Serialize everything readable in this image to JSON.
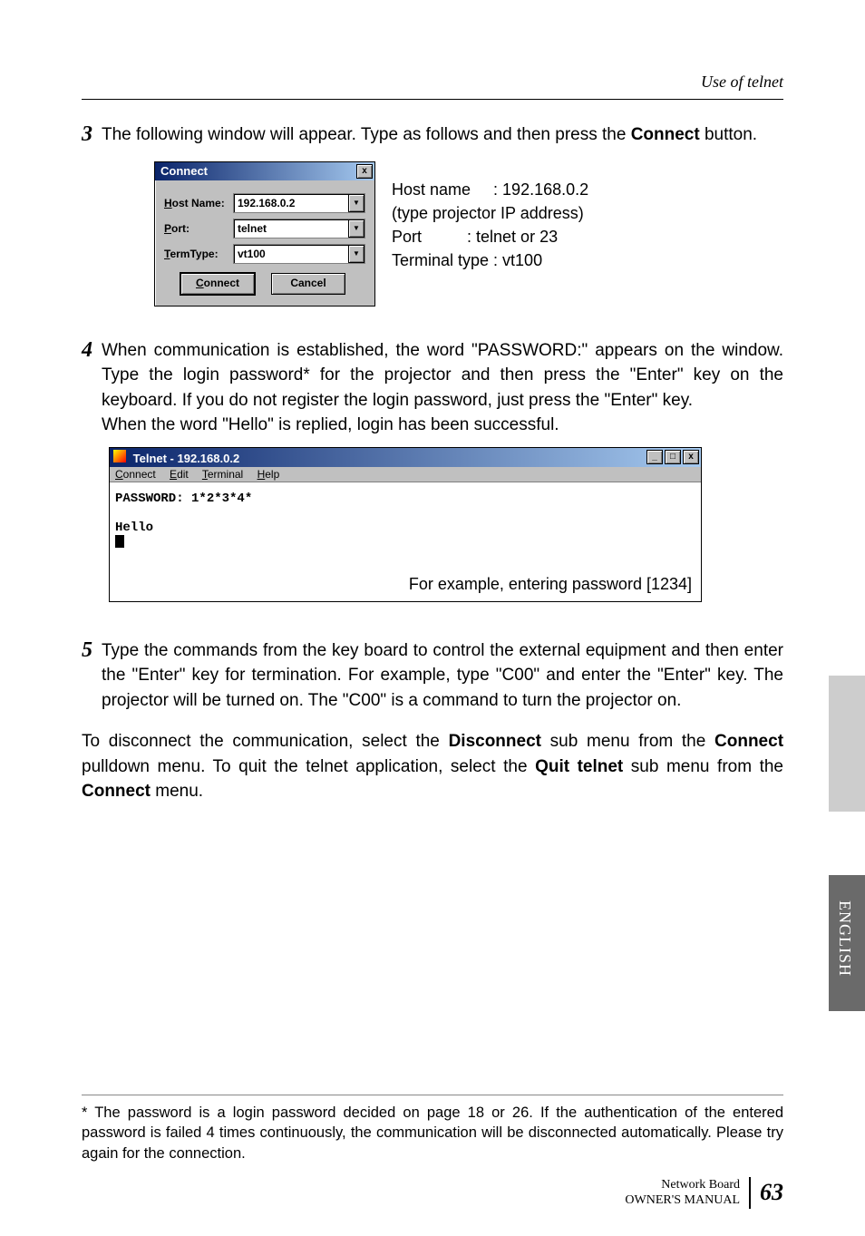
{
  "header": {
    "section": "Use of telnet"
  },
  "step3": {
    "num": "3",
    "text_a": "The following window will appear. Type as follows and then press the ",
    "connect_word": "Connect",
    "text_b": " button."
  },
  "connect_dialog": {
    "title": "Connect",
    "close_glyph": "x",
    "host_label": "Host Name:",
    "host_value": "192.168.0.2",
    "port_label": "Port:",
    "port_value": "telnet",
    "term_label": "TermType:",
    "term_value": "vt100",
    "dd_glyph": "▼",
    "btn_connect": "Connect",
    "btn_cancel": "Cancel"
  },
  "side_info": {
    "line1": "Host name     : 192.168.0.2",
    "line2": "(type projector IP address)",
    "line3": "Port          : telnet or 23",
    "line4": "Terminal type : vt100"
  },
  "step4": {
    "num": "4",
    "para1": "When communication is established, the word \"PASSWORD:\" appears on the window. Type the login password* for the projector and then press the \"Enter\" key on the keyboard. If you do not register the login password, just press the \"Enter\" key.",
    "para2": "When the word \"Hello\" is replied, login has been successful."
  },
  "telnet": {
    "title": "Telnet - 192.168.0.2",
    "menu": {
      "connect": "Connect",
      "edit": "Edit",
      "terminal": "Terminal",
      "help": "Help"
    },
    "controls": {
      "min": "_",
      "max": "□",
      "close": "x"
    },
    "term_lines": "PASSWORD: 1*2*3*4*\n\nHello",
    "footer_example": "For example, entering password [1234]"
  },
  "step5": {
    "num": "5",
    "para1": "Type the commands from the key board to control the external equipment and then enter the \"Enter\" key for termination. For example, type \"C00\" and enter the \"Enter\" key. The projector will be turned on. The \"C00\" is a command to turn the projector on.",
    "para2a": "To disconnect the communication, select the ",
    "disconnect": "Disconnect",
    "para2b": " sub menu from the ",
    "connect1": "Connect",
    "para2c": " pulldown menu. To quit the telnet application, select the ",
    "quit": "Quit telnet",
    "para2d": " sub menu from the ",
    "connect2": "Connect",
    "para2e": " menu."
  },
  "footnote": "* The password is a login password decided on page 18 or 26. If the authentication of the entered password is failed 4 times continuously, the communication will be disconnected automatically. Please try again for the connection.",
  "footer": {
    "line1": "Network Board",
    "line2": "OWNER'S MANUAL",
    "page": "63"
  },
  "tabs": {
    "english": "ENGLISH"
  }
}
